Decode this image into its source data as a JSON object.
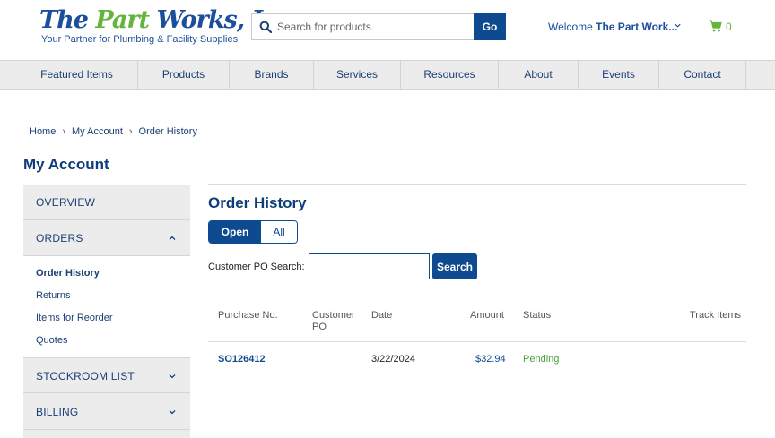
{
  "header": {
    "logo_text_before": "The ",
    "logo_text_green": "Part",
    "logo_text_after": " Works, Inc.",
    "logo_tagline": "Your Partner for Plumbing & Facility Supplies",
    "search_placeholder": "Search for products",
    "go_label": "Go",
    "welcome_prefix": "Welcome ",
    "welcome_name": "The Part Work...",
    "cart_count": "0"
  },
  "nav": {
    "items": [
      {
        "label": "Featured Items"
      },
      {
        "label": "Products"
      },
      {
        "label": "Brands"
      },
      {
        "label": "Services"
      },
      {
        "label": "Resources"
      },
      {
        "label": "About"
      },
      {
        "label": "Events"
      },
      {
        "label": "Contact"
      }
    ]
  },
  "breadcrumb": {
    "items": [
      "Home",
      "My Account",
      "Order History"
    ],
    "separator": "›"
  },
  "sidebar": {
    "title": "My Account",
    "sections": [
      {
        "label": "OVERVIEW"
      },
      {
        "label": "ORDERS"
      },
      {
        "label": "STOCKROOM LIST"
      },
      {
        "label": "BILLING"
      }
    ],
    "orders_links": [
      {
        "label": "Order History",
        "active": true
      },
      {
        "label": "Returns"
      },
      {
        "label": "Items for Reorder"
      },
      {
        "label": "Quotes"
      }
    ]
  },
  "main": {
    "title": "Order History",
    "toggle": {
      "open": "Open",
      "all": "All",
      "selected": "Open"
    },
    "po_search_label": "Customer PO Search:",
    "po_search_value": "",
    "search_button": "Search",
    "columns": {
      "purchase_no": "Purchase No.",
      "customer_po_line1": "Customer",
      "customer_po_line2": "PO",
      "date": "Date",
      "amount": "Amount",
      "status": "Status",
      "track": "Track Items"
    },
    "rows": [
      {
        "purchase_no": "SO126412",
        "customer_po": "",
        "date": "3/22/2024",
        "amount": "$32.94",
        "status": "Pending",
        "track": ""
      }
    ]
  },
  "colors": {
    "brand_blue": "#0d4a8f",
    "brand_green": "#64b53d",
    "status_pending": "#4ca23a",
    "nav_bg": "#ececec"
  },
  "icons": [
    "search-icon",
    "chevron-down-icon",
    "cart-icon",
    "chevron-up-icon"
  ]
}
